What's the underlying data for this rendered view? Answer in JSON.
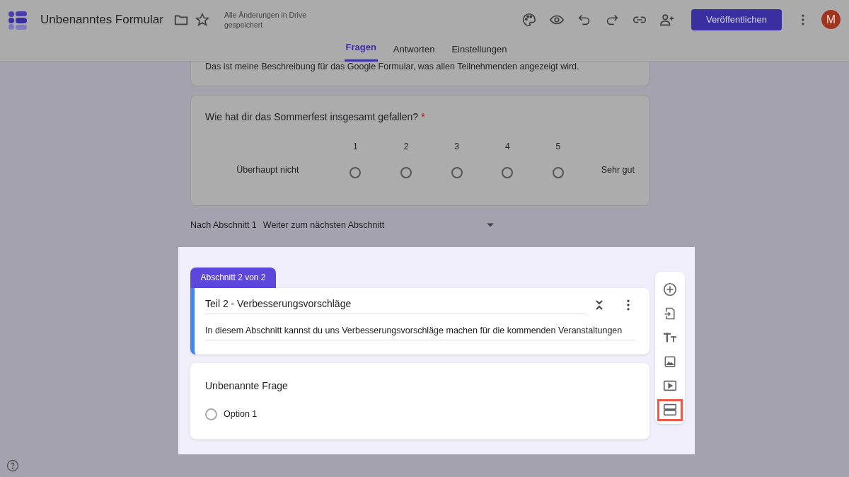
{
  "header": {
    "title": "Unbenanntes Formular",
    "save_status": "Alle Änderungen in Drive gespeichert",
    "publish_button": "Veröffentlichen",
    "avatar": "M"
  },
  "tabs": [
    {
      "label": "Fragen",
      "selected": true
    },
    {
      "label": "Antworten",
      "selected": false
    },
    {
      "label": "Einstellungen",
      "selected": false
    }
  ],
  "form_description": "Das ist meine Beschreibung für das Google Formular, was allen Teilnehmenden angezeigt wird.",
  "scale_question": {
    "title": "Wie hat dir das Sommerfest insgesamt gefallen?",
    "required_mark": "*",
    "low_label": "Überhaupt nicht",
    "high_label": "Sehr gut",
    "points": [
      {
        "label": "1",
        "selected": false
      },
      {
        "label": "2",
        "selected": false
      },
      {
        "label": "3",
        "selected": false
      },
      {
        "label": "4",
        "selected": false
      },
      {
        "label": "5",
        "selected": false
      }
    ]
  },
  "section_navigation": {
    "label": "Nach Abschnitt 1",
    "value": "Weiter zum nächsten Abschnitt"
  },
  "section": {
    "badge": "Abschnitt 2 von 2",
    "title": "Teil 2 - Verbesserungsvorschläge",
    "description": "In diesem Abschnitt kannst du uns Verbesserungsvorschläge machen für die kommenden Veranstaltungen"
  },
  "question": {
    "title": "Unbenannte Frage",
    "options": [
      {
        "label": "Option 1",
        "selected": false
      }
    ]
  },
  "toolbar": [
    {
      "kind": "add",
      "highlighted": false
    },
    {
      "kind": "import",
      "highlighted": false
    },
    {
      "kind": "text",
      "highlighted": false
    },
    {
      "kind": "image",
      "highlighted": false
    },
    {
      "kind": "video",
      "highlighted": false
    },
    {
      "kind": "section",
      "highlighted": true
    }
  ]
}
